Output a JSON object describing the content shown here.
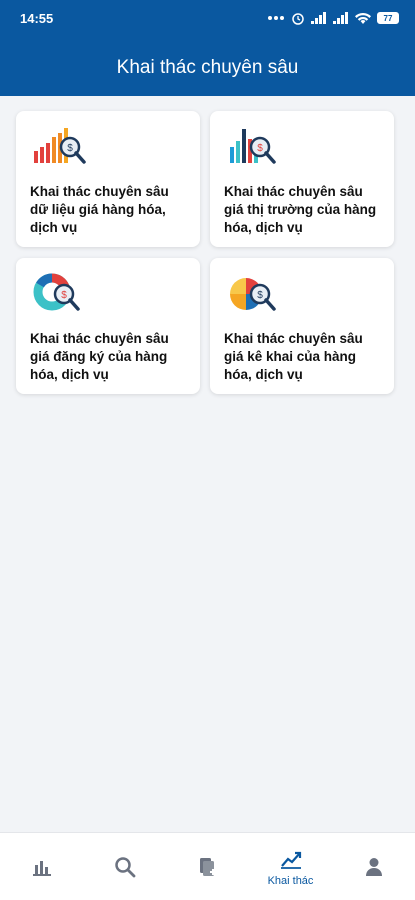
{
  "status_bar": {
    "time": "14:55",
    "battery": "77"
  },
  "header": {
    "title": "Khai thác chuyên sâu"
  },
  "cards": [
    {
      "label": "Khai thác chuyên sâu dữ liệu giá hàng hóa, dịch vụ",
      "icon": "bar-chart-magnifier-icon"
    },
    {
      "label": "Khai thác chuyên sâu giá thị trường của hàng hóa, dịch vụ",
      "icon": "market-chart-magnifier-icon"
    },
    {
      "label": "Khai thác chuyên sâu giá đăng ký của hàng hóa, dịch vụ",
      "icon": "donut-chart-magnifier-icon"
    },
    {
      "label": "Khai thác chuyên sâu giá kê khai của hàng hóa, dịch vụ",
      "icon": "pie-chart-magnifier-icon"
    }
  ],
  "bottom_nav": {
    "active_label": "Khai thác",
    "items": [
      "statistics-icon",
      "search-icon",
      "add-document-icon",
      "trend-chart-icon",
      "user-icon"
    ]
  },
  "colors": {
    "primary": "#0a58a0",
    "background": "#f2f4f7"
  }
}
